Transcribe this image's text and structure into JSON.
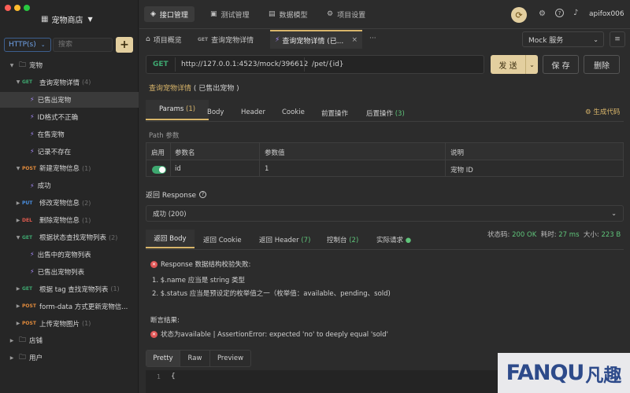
{
  "sidebar": {
    "project_name": "宠物商店",
    "protocol": "HTTP(s)",
    "search_placeholder": "搜索",
    "add_label": "+",
    "tree": [
      {
        "label": "宠物",
        "kind": "folder"
      },
      {
        "method": "GET",
        "label": "查询宠物详情",
        "count": "(4)"
      },
      {
        "label": "已售出宠物",
        "kind": "case"
      },
      {
        "label": "ID格式不正确",
        "kind": "case"
      },
      {
        "label": "在售宠物",
        "kind": "case"
      },
      {
        "label": "记录不存在",
        "kind": "case"
      },
      {
        "method": "POST",
        "label": "新建宠物信息",
        "count": "(1)"
      },
      {
        "label": "成功",
        "kind": "case"
      },
      {
        "method": "PUT",
        "label": "修改宠物信息",
        "count": "(2)"
      },
      {
        "method": "DEL",
        "label": "删除宠物信息",
        "count": "(1)"
      },
      {
        "method": "GET",
        "label": "根据状态查找宠物列表",
        "count": "(2)"
      },
      {
        "label": "出售中的宠物列表",
        "kind": "case"
      },
      {
        "label": "已售出宠物列表",
        "kind": "case"
      },
      {
        "method": "GET",
        "label": "根据 tag 查找宠物列表",
        "count": "(1)"
      },
      {
        "method": "POST",
        "label": "form-data 方式更新宠物信...",
        "count": ""
      },
      {
        "method": "POST",
        "label": "上传宠物图片",
        "count": "(1)"
      },
      {
        "label": "店铺",
        "kind": "folder"
      },
      {
        "label": "用户",
        "kind": "folder"
      }
    ]
  },
  "topnav": {
    "tabs": [
      "接口管理",
      "测试管理",
      "数据模型",
      "项目设置"
    ],
    "user": "apifox006"
  },
  "doc_tabs": {
    "overview": "项目概览",
    "tab2_method": "GET",
    "tab2": "查询宠物详情",
    "tab3": "查询宠物详情 (已...",
    "more": "···",
    "env": "Mock 服务"
  },
  "request": {
    "method": "GET",
    "base_url": "http://127.0.0.1:4523/mock/396612",
    "path": "/pet/{id}",
    "send": "发 送",
    "save": "保 存",
    "delete": "删除",
    "breadcrumb_link": "查询宠物详情",
    "breadcrumb_rest": "( 已售出宠物 )"
  },
  "params_tabs": {
    "params": "Params",
    "params_count": "(1)",
    "body": "Body",
    "header": "Header",
    "cookie": "Cookie",
    "pre": "前置操作",
    "post": "后置操作",
    "post_count": "(3)",
    "gen_code": "生成代码"
  },
  "path_params": {
    "section": "Path 参数",
    "headers": [
      "启用",
      "参数名",
      "参数值",
      "说明"
    ],
    "row": {
      "name": "id",
      "value": "1",
      "desc": "宠物 ID"
    }
  },
  "response": {
    "label": "返回 Response",
    "selected": "成功 (200)",
    "tabs": {
      "body": "返回 Body",
      "cookie": "返回 Cookie",
      "header": "返回 Header",
      "header_count": "(7)",
      "console": "控制台",
      "console_count": "(2)",
      "actual": "实际请求"
    },
    "status_label": "状态码:",
    "status_value": "200 OK",
    "time_label": "耗时:",
    "time_value": "27 ms",
    "size_label": "大小:",
    "size_value": "223 B",
    "error_title": "Response 数据结构校验失败:",
    "errors": [
      "1. $.name 应当是 string 类型",
      "2. $.status 应当是预设定的枚举值之一（枚举值：available、pending、sold)"
    ],
    "assert_title": "断言结果:",
    "assert_msg": "状态为available | AssertionError: expected 'no' to deeply equal 'sold'",
    "view_tabs": [
      "Pretty",
      "Raw",
      "Preview"
    ],
    "line_no": "1"
  },
  "watermark": {
    "text": "FANQU",
    "cn": "凡趣"
  },
  "colors": {
    "accent": "#d8b56a",
    "send_bg": "#e3cf9f",
    "success": "#5fc47a",
    "error": "#e05555",
    "link": "#d8b56a"
  }
}
